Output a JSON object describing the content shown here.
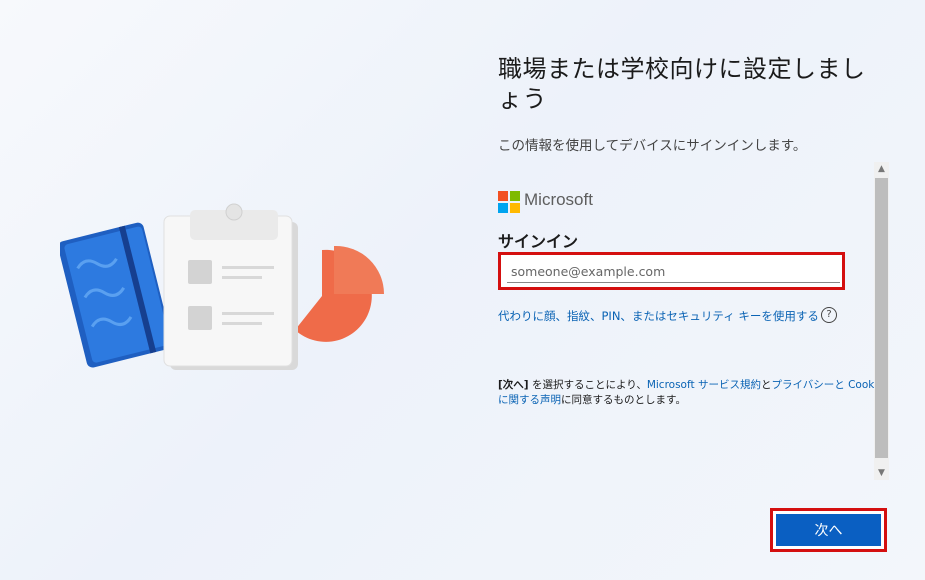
{
  "page": {
    "title": "職場または学校向けに設定しましょう",
    "subtitle": "この情報を使用してデバイスにサインインします。"
  },
  "brand": {
    "name": "Microsoft",
    "logo_colors": [
      "#f25022",
      "#7fba00",
      "#00a4ef",
      "#ffb900"
    ]
  },
  "signin": {
    "heading": "サインイン",
    "email_placeholder": "someone@example.com",
    "email_value": "",
    "alt_link": "代わりに顔、指紋、PIN、またはセキュリティ キーを使用する",
    "help_icon": "?"
  },
  "terms": {
    "bracket_next": "[次へ]",
    "text1": " を選択することにより、",
    "link1": "Microsoft サービス規約",
    "and": "と",
    "link2a": "プライバシーと Cook",
    "link2b": "に関する声明",
    "text2": "に同意するものとします。"
  },
  "scrollbar": {
    "up": "▲",
    "down": "▼"
  },
  "footer": {
    "next_label": "次へ"
  },
  "colors": {
    "accent": "#0a5fc2",
    "link": "#0a63b4",
    "highlight": "#d40f0f"
  }
}
